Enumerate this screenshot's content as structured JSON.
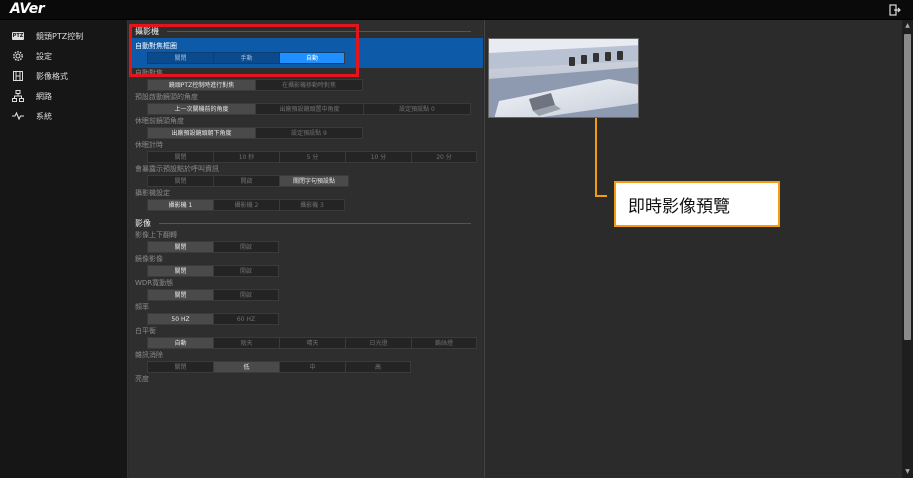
{
  "app": {
    "logo": "AVer"
  },
  "sidebar": {
    "items": [
      {
        "label": "鏡頭PTZ控制",
        "icon": "ptz-icon",
        "badge": "PTZ",
        "active": false
      },
      {
        "label": "設定",
        "icon": "gear-icon",
        "active": true
      },
      {
        "label": "影像格式",
        "icon": "film-icon",
        "active": false
      },
      {
        "label": "網路",
        "icon": "network-icon",
        "active": false
      },
      {
        "label": "系統",
        "icon": "pulse-icon",
        "active": false
      }
    ]
  },
  "camera_section": {
    "title": "攝影機",
    "auto_framing": {
      "label": "自動對焦框圈",
      "options": [
        "關閉",
        "手動",
        "自動"
      ],
      "selected": 2
    },
    "auto_focus": {
      "label": "自動對焦",
      "options": [
        "鏡頭PTZ控制時進行對焦",
        "在攝影機移動時對焦"
      ],
      "selected": 0
    },
    "startup_angle": {
      "label": "預設啟動鏡頭的角度",
      "options": [
        "上一次關機前的角度",
        "出廠預設鏡頭置中角度",
        "設定預設點 0"
      ],
      "selected": 0
    },
    "sleep_angle": {
      "label": "休眠前鏡頭角度",
      "options": [
        "出廠預設鏡頭朝下角度",
        "設定預設點 9"
      ],
      "selected": 0
    },
    "sleep_timer": {
      "label": "休眠計時",
      "options": [
        "關閉",
        "10 秒",
        "5 分",
        "10 分",
        "20 分"
      ],
      "selected": -1
    },
    "preset_call": {
      "label": "會暴露示預設點於呼叫資訊",
      "options": [
        "關閉",
        "開啟",
        "關閉字句預設點"
      ],
      "selected": 2
    },
    "camera_id": {
      "label": "攝影機設定",
      "options": [
        "攝影機 1",
        "攝影機 2",
        "攝影機 3"
      ],
      "selected": 0
    }
  },
  "image_section": {
    "title": "影像",
    "flip": {
      "label": "影像上下翻轉",
      "options": [
        "關閉",
        "開啟"
      ],
      "selected": 0
    },
    "mirror": {
      "label": "鏡像影像",
      "options": [
        "關閉",
        "開啟"
      ],
      "selected": 0
    },
    "wdr": {
      "label": "WDR寬動態",
      "options": [
        "關閉",
        "開啟"
      ],
      "selected": 0
    },
    "frequency": {
      "label": "頻率",
      "options": [
        "50 HZ",
        "60 HZ"
      ],
      "selected": 0
    },
    "white_balance": {
      "label": "白平衡",
      "options": [
        "自動",
        "陰天",
        "晴天",
        "日光燈",
        "鎢絲燈"
      ],
      "selected": 0
    },
    "noise_reduction": {
      "label": "雜訊消除",
      "options": [
        "關閉",
        "低",
        "中",
        "高"
      ],
      "selected": 1
    },
    "next_label": "亮度"
  },
  "preview": {
    "callout": "即時影像預覽"
  },
  "colors": {
    "accent": "#1e90ff",
    "highlight": "#0d5aa8",
    "annotation_red": "#e3141b",
    "annotation_orange": "#f39c12"
  }
}
